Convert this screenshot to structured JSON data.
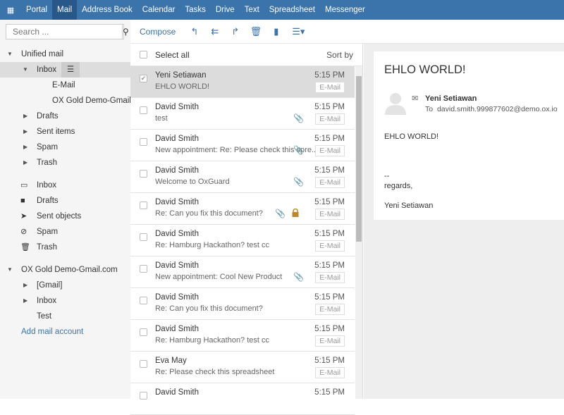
{
  "topbar": {
    "apps": [
      "Portal",
      "Mail",
      "Address Book",
      "Calendar",
      "Tasks",
      "Drive",
      "Text",
      "Spreadsheet",
      "Messenger"
    ],
    "active": "Mail"
  },
  "search": {
    "placeholder": "Search ..."
  },
  "tree": {
    "unified": "Unified mail",
    "inbox": "Inbox",
    "email": "E-Mail",
    "oxgold_sub": "OX Gold Demo-Gmail.com",
    "drafts": "Drafts",
    "sent": "Sent items",
    "spam": "Spam",
    "trash": "Trash",
    "inbox2": "Inbox",
    "drafts2": "Drafts",
    "sent2": "Sent objects",
    "spam2": "Spam",
    "trash2": "Trash",
    "account": "OX Gold Demo-Gmail.com",
    "gmail": "[Gmail]",
    "inbox3": "Inbox",
    "test": "Test",
    "add": "Add mail account"
  },
  "toolbar": {
    "compose": "Compose"
  },
  "list": {
    "select_all": "Select all",
    "sort_by": "Sort by",
    "messages": [
      {
        "from": "Yeni Setiawan",
        "subject": "EHLO WORLD!",
        "time": "5:15 PM",
        "badge": "E-Mail",
        "selected": true
      },
      {
        "from": "David Smith",
        "subject": "test",
        "time": "5:15 PM",
        "badge": "E-Mail",
        "attachment": true
      },
      {
        "from": "David Smith",
        "subject": "New appointment: Re: Please check this spre...",
        "time": "5:15 PM",
        "badge": "E-Mail",
        "attachment": true
      },
      {
        "from": "David Smith",
        "subject": "Welcome to OxGuard",
        "time": "5:15 PM",
        "badge": "E-Mail",
        "attachment": true
      },
      {
        "from": "David Smith",
        "subject": "Re: Can you fix this document?",
        "time": "5:15 PM",
        "badge": "E-Mail",
        "attachment": true,
        "encrypted": true
      },
      {
        "from": "David Smith",
        "subject": "Re: Hamburg Hackathon? test cc",
        "time": "5:15 PM",
        "badge": "E-Mail"
      },
      {
        "from": "David Smith",
        "subject": "New appointment: Cool New Product",
        "time": "5:15 PM",
        "badge": "E-Mail",
        "attachment": true
      },
      {
        "from": "David Smith",
        "subject": "Re: Can you fix this document?",
        "time": "5:15 PM",
        "badge": "E-Mail"
      },
      {
        "from": "David Smith",
        "subject": "Re: Hamburg Hackathon? test cc",
        "time": "5:15 PM",
        "badge": "E-Mail"
      },
      {
        "from": "Eva May",
        "subject": "Re: Please check this spreadsheet",
        "time": "5:15 PM",
        "badge": "E-Mail"
      },
      {
        "from": "David Smith",
        "subject": "",
        "time": "5:15 PM",
        "badge": ""
      }
    ]
  },
  "detail": {
    "subject": "EHLO WORLD!",
    "sender": "Yeni Setiawan",
    "to_label": "To",
    "to": "david.smith.999877602@demo.ox.io",
    "body": [
      "EHLO WORLD!",
      "",
      "",
      "--",
      "regards,",
      "",
      "Yeni Setiawan"
    ]
  },
  "colors": {
    "accent": "#3b73ab",
    "lock": "#c0872a"
  }
}
